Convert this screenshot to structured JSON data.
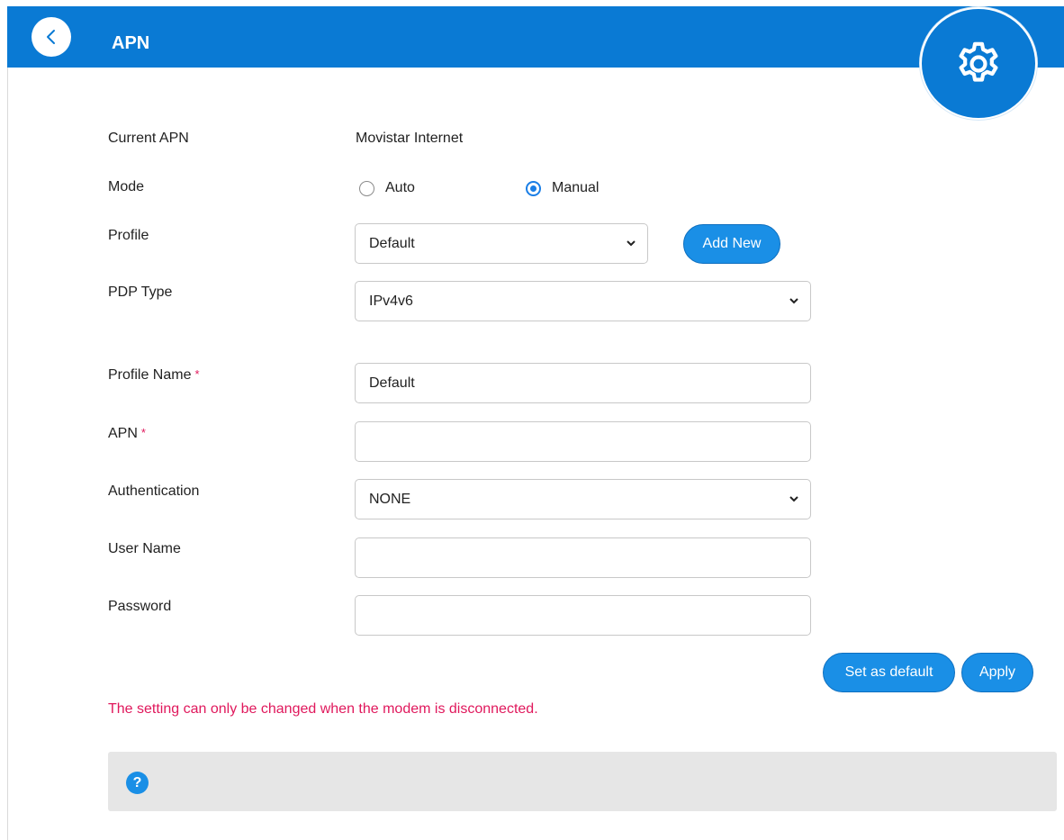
{
  "header": {
    "title": "APN",
    "back_icon": "chevron-left-icon",
    "settings_icon": "gear-icon"
  },
  "form": {
    "current_apn": {
      "label": "Current APN",
      "value": "Movistar Internet"
    },
    "mode": {
      "label": "Mode",
      "options": [
        "Auto",
        "Manual"
      ],
      "selected": "Manual"
    },
    "profile": {
      "label": "Profile",
      "value": "Default",
      "add_button": "Add New"
    },
    "pdp_type": {
      "label": "PDP Type",
      "value": "IPv4v6"
    },
    "profile_name": {
      "label": "Profile Name",
      "required_mark": "*",
      "value": "Default"
    },
    "apn": {
      "label": "APN",
      "required_mark": "*",
      "value": ""
    },
    "authentication": {
      "label": "Authentication",
      "value": "NONE"
    },
    "user_name": {
      "label": "User Name",
      "value": ""
    },
    "password": {
      "label": "Password",
      "value": ""
    }
  },
  "actions": {
    "set_default": "Set as default",
    "apply": "Apply"
  },
  "notice": "The setting can only be changed when the modem is disconnected.",
  "help": {
    "icon": "question-icon",
    "symbol": "?"
  },
  "colors": {
    "header": "#0a7ad4",
    "button": "#1a8fe6",
    "alert": "#e0185c",
    "help_bg": "#e6e6e6"
  }
}
